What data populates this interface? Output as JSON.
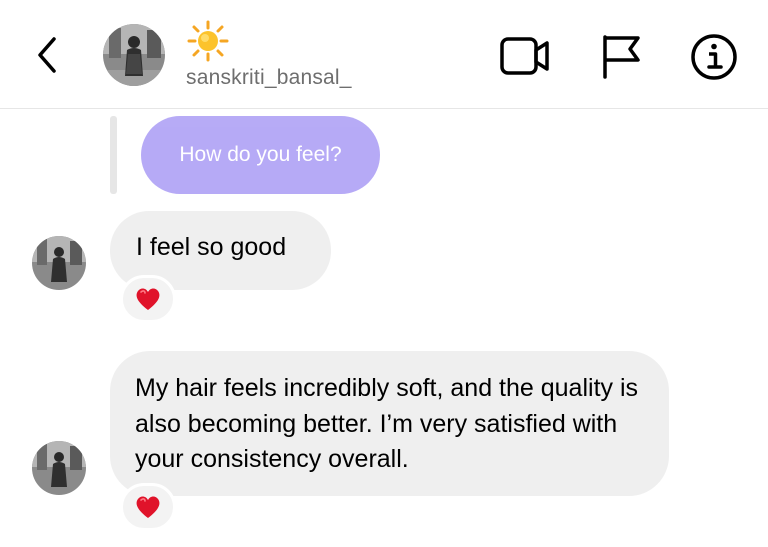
{
  "header": {
    "username": "sanskriti_bansal_",
    "status_icon": "sun-icon",
    "back_icon": "chevron-left-icon",
    "actions": [
      "video-call-icon",
      "flag-icon",
      "info-icon"
    ]
  },
  "thread": {
    "quoted_reply": {
      "text": "How do you feel?",
      "color": "#b3a6f6"
    },
    "messages": [
      {
        "text": "I feel so good",
        "reaction": "heart-icon"
      },
      {
        "text": "My hair feels incredibly soft, and the quality is also becoming better. I’m very satisfied with your consistency overall.",
        "reaction": "heart-icon"
      }
    ]
  },
  "colors": {
    "bubble": "#efefef",
    "username": "#6e6e6e",
    "heart": "#e0132a",
    "divider": "#e6e6e6"
  }
}
